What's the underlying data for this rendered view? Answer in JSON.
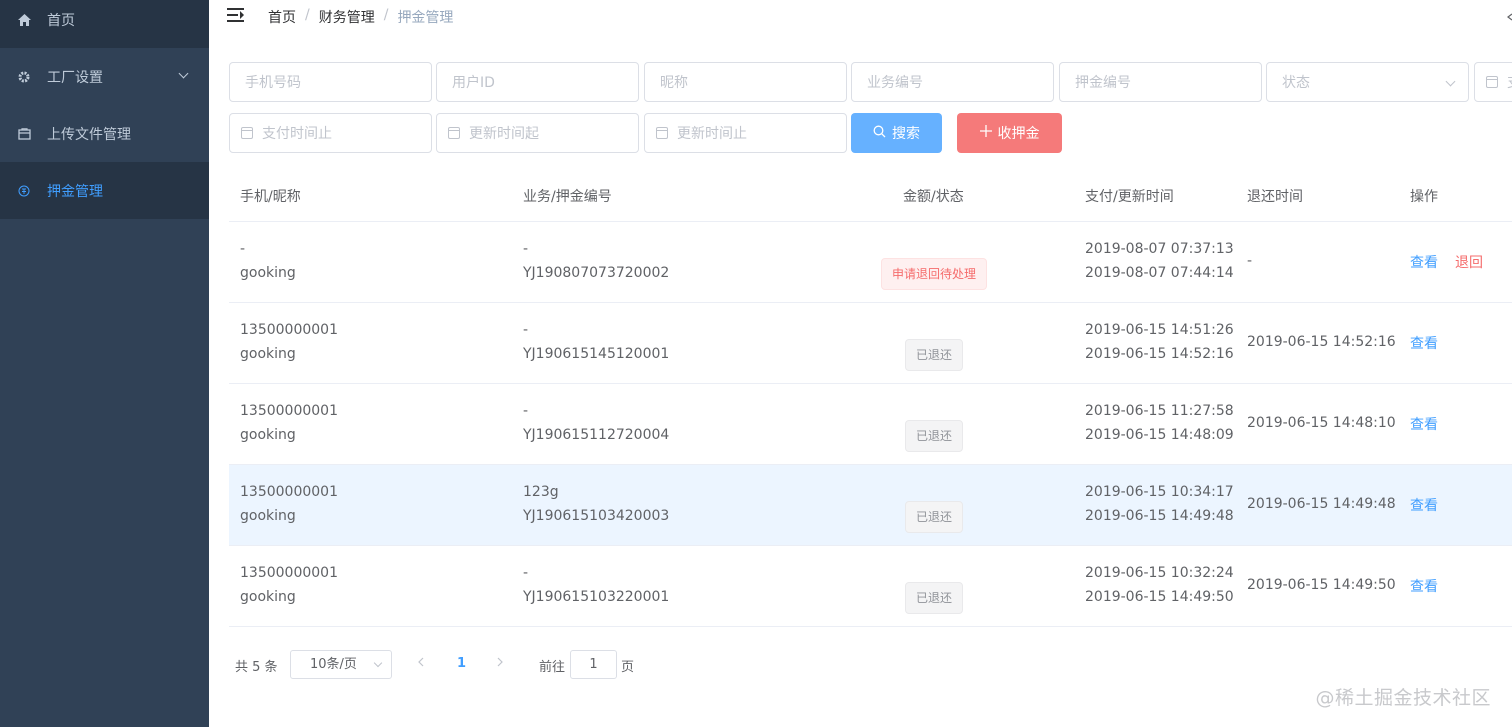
{
  "sidebar": {
    "items": [
      {
        "label": "首页",
        "icon": "home-icon"
      },
      {
        "label": "工厂设置",
        "icon": "gear-icon"
      },
      {
        "label": "上传文件管理",
        "icon": "folder-icon"
      },
      {
        "label": "押金管理",
        "icon": "deposit-icon",
        "active": true
      }
    ]
  },
  "breadcrumb": [
    "首页",
    "财务管理",
    "押金管理"
  ],
  "filters": {
    "phone_placeholder": "手机号码",
    "userid_placeholder": "用户ID",
    "nickname_placeholder": "昵称",
    "business_no_placeholder": "业务编号",
    "deposit_no_placeholder": "押金编号",
    "status_placeholder": "状态",
    "pay_start_placeholder": "支",
    "pay_end_placeholder": "支付时间止",
    "update_start_placeholder": "更新时间起",
    "update_end_placeholder": "更新时间止",
    "search_label": "搜索",
    "collect_label": "收押金"
  },
  "table": {
    "headers": [
      "手机/昵称",
      "业务/押金编号",
      "金额/状态",
      "支付/更新时间",
      "退还时间",
      "操作"
    ],
    "rows": [
      {
        "phone": "-",
        "nickname": "gooking",
        "business": "-",
        "deposit_no": "YJ190807073720002",
        "status": "申请退回待处理",
        "status_type": "danger",
        "paid": "2019-08-07 07:37:13",
        "updated": "2019-08-07 07:44:14",
        "returned": "-",
        "view": "查看",
        "refund": "退回"
      },
      {
        "phone": "13500000001",
        "nickname": "gooking",
        "business": "-",
        "deposit_no": "YJ190615145120001",
        "status": "已退还",
        "status_type": "info",
        "paid": "2019-06-15 14:51:26",
        "updated": "2019-06-15 14:52:16",
        "returned": "2019-06-15 14:52:16",
        "view": "查看"
      },
      {
        "phone": "13500000001",
        "nickname": "gooking",
        "business": "-",
        "deposit_no": "YJ190615112720004",
        "status": "已退还",
        "status_type": "info",
        "paid": "2019-06-15 11:27:58",
        "updated": "2019-06-15 14:48:09",
        "returned": "2019-06-15 14:48:10",
        "view": "查看"
      },
      {
        "phone": "13500000001",
        "nickname": "gooking",
        "business": "123g",
        "deposit_no": "YJ190615103420003",
        "status": "已退还",
        "status_type": "info",
        "paid": "2019-06-15 10:34:17",
        "updated": "2019-06-15 14:49:48",
        "returned": "2019-06-15 14:49:48",
        "view": "查看",
        "highlight": true
      },
      {
        "phone": "13500000001",
        "nickname": "gooking",
        "business": "-",
        "deposit_no": "YJ190615103220001",
        "status": "已退还",
        "status_type": "info",
        "paid": "2019-06-15 10:32:24",
        "updated": "2019-06-15 14:49:50",
        "returned": "2019-06-15 14:49:50",
        "view": "查看"
      }
    ]
  },
  "pagination": {
    "total": "共 5 条",
    "page_size": "10条/页",
    "current": "1",
    "goto_prefix": "前往",
    "goto_value": "1",
    "goto_suffix": "页"
  },
  "watermark": "@稀土掘金技术社区"
}
